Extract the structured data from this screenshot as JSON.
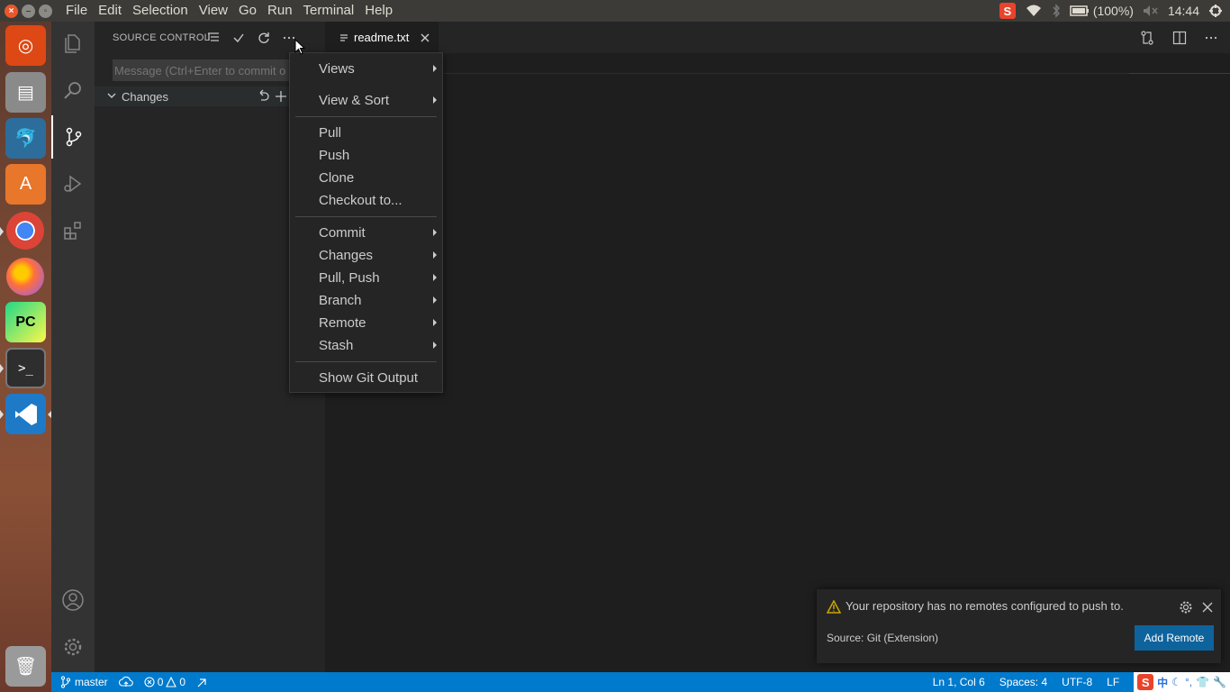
{
  "topbar": {
    "menu": [
      "File",
      "Edit",
      "Selection",
      "View",
      "Go",
      "Run",
      "Terminal",
      "Help"
    ],
    "battery": "(100%)",
    "time": "14:44",
    "tray_icons": [
      "sogou-icon",
      "wifi-icon",
      "bluetooth-icon",
      "battery-icon",
      "volume-muted-icon",
      "power-icon"
    ]
  },
  "launcher": {
    "items": [
      "ubuntu-dash",
      "files",
      "mysql-workbench",
      "software-store",
      "chrome",
      "firefox",
      "pycharm",
      "terminal",
      "vscode",
      "trash"
    ]
  },
  "sidebar": {
    "title": "SOURCE CONTROL",
    "message_placeholder": "Message (Ctrl+Enter to commit o",
    "changes_label": "Changes"
  },
  "editor": {
    "tab_label": "readme.txt"
  },
  "context_menu": {
    "items": [
      {
        "label": "Views",
        "submenu": true
      },
      {
        "label": "View & Sort",
        "submenu": true
      },
      {
        "label": "Pull",
        "submenu": false
      },
      {
        "label": "Push",
        "submenu": false
      },
      {
        "label": "Clone",
        "submenu": false
      },
      {
        "label": "Checkout to...",
        "submenu": false
      },
      {
        "label": "Commit",
        "submenu": true
      },
      {
        "label": "Changes",
        "submenu": true
      },
      {
        "label": "Pull, Push",
        "submenu": true
      },
      {
        "label": "Branch",
        "submenu": true
      },
      {
        "label": "Remote",
        "submenu": true
      },
      {
        "label": "Stash",
        "submenu": true
      },
      {
        "label": "Show Git Output",
        "submenu": false
      }
    ]
  },
  "notification": {
    "message": "Your repository has no remotes configured to push to.",
    "source": "Source: Git (Extension)",
    "action_label": "Add Remote"
  },
  "statusbar": {
    "branch": "master",
    "errors": "0",
    "warnings": "0",
    "position": "Ln 1, Col 6",
    "spaces": "Spaces: 4",
    "encoding": "UTF-8",
    "eol": "LF",
    "ime_label": "中"
  },
  "colors": {
    "accent": "#007acc",
    "button": "#0e639c",
    "warning": "#cca700"
  }
}
